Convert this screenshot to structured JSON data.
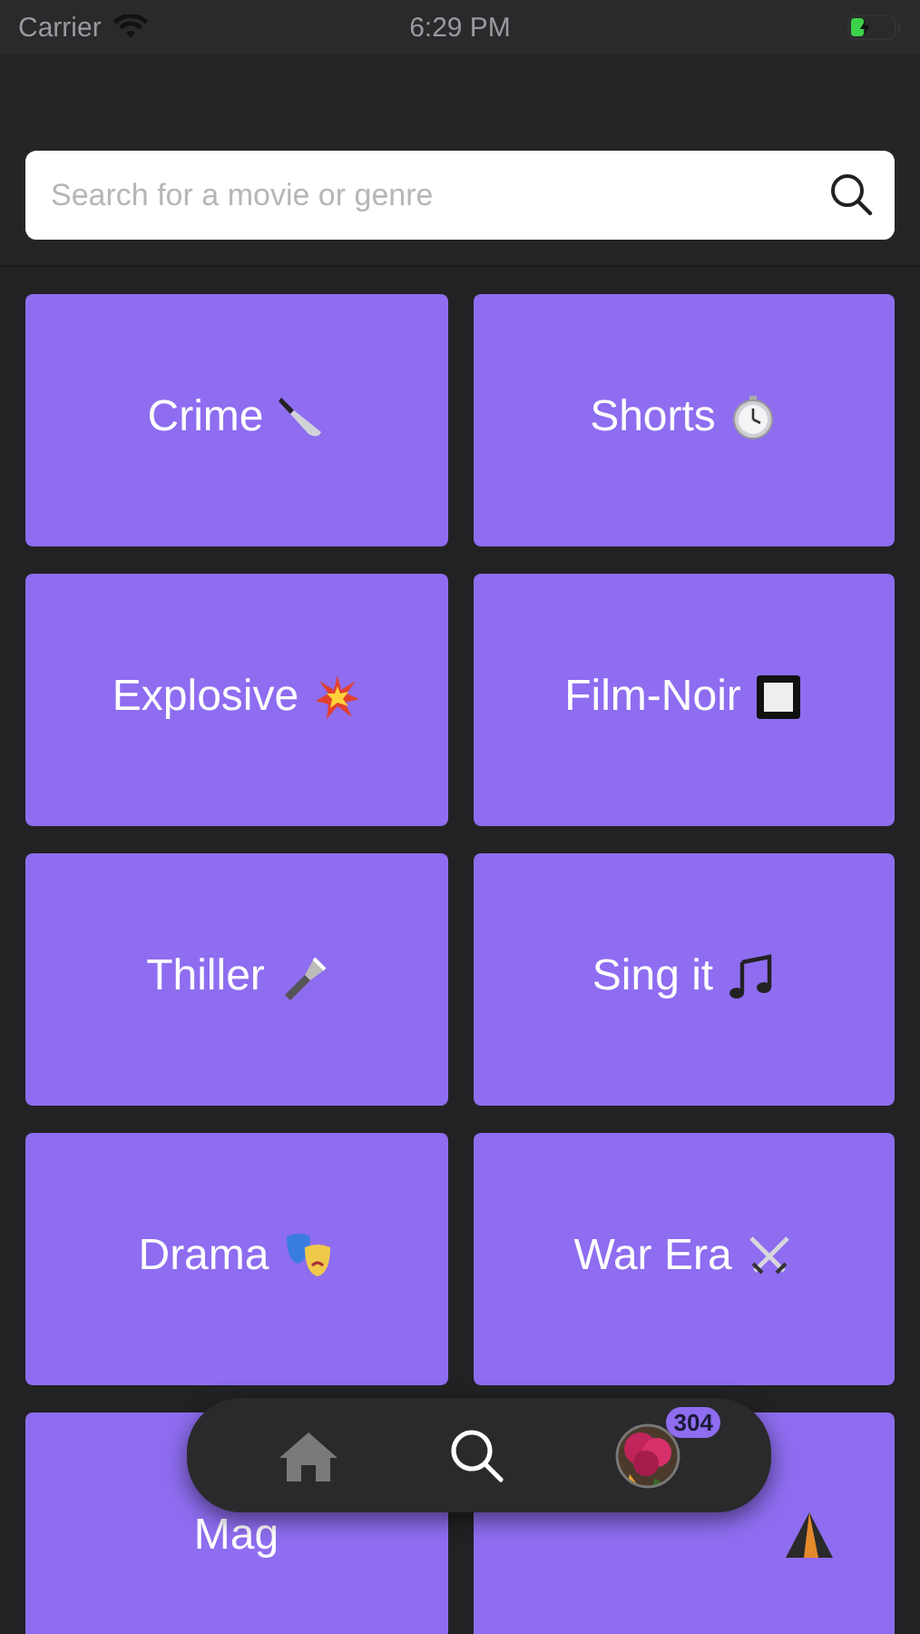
{
  "status_bar": {
    "carrier": "Carrier",
    "time": "6:29 PM"
  },
  "search": {
    "placeholder": "Search for a movie or genre"
  },
  "genres": [
    {
      "kind": "labeled",
      "label": "Crime"
    },
    {
      "kind": "labeled",
      "label": "Shorts"
    },
    {
      "kind": "labeled",
      "label": "Explosive"
    },
    {
      "kind": "labeled",
      "label": "Film-Noir"
    },
    {
      "kind": "labeled",
      "label": "Thiller"
    },
    {
      "kind": "labeled",
      "label": "Sing it"
    },
    {
      "kind": "labeled",
      "label": "Drama"
    },
    {
      "kind": "labeled",
      "label": "War Era"
    },
    {
      "kind": "labeled",
      "label": "Mag"
    },
    {
      "kind": "icon_only"
    }
  ],
  "tab_bar": {
    "items": [
      {
        "kind": "home",
        "selected": false
      },
      {
        "kind": "search",
        "selected": true
      },
      {
        "kind": "profile",
        "selected": false,
        "badge": "304"
      }
    ]
  }
}
